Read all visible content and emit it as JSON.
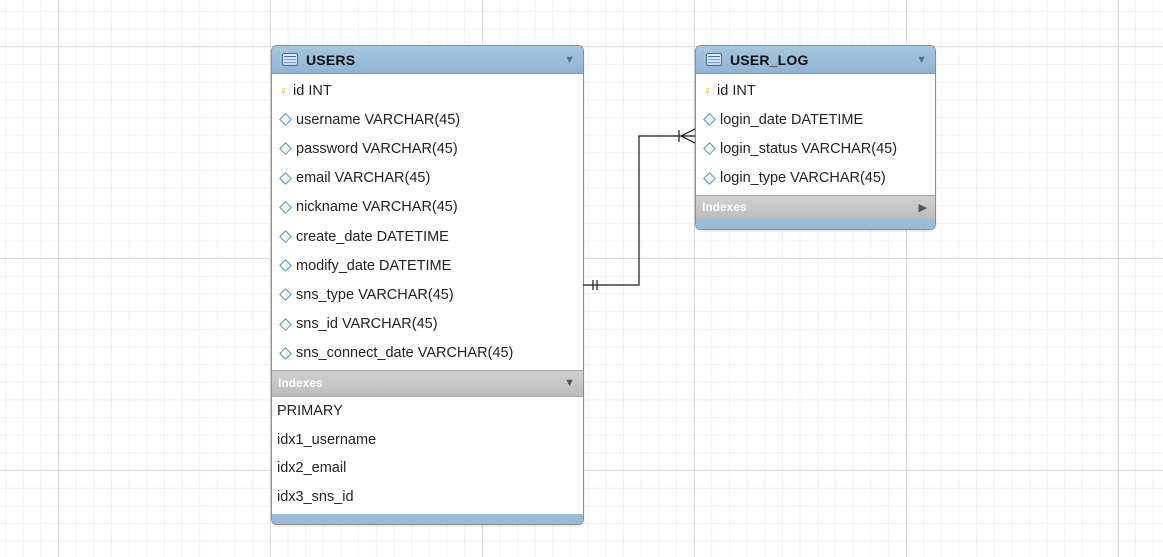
{
  "tables": {
    "users": {
      "name": "USERS",
      "columns": [
        {
          "label": "id INT",
          "key": true
        },
        {
          "label": "username VARCHAR(45)",
          "key": false
        },
        {
          "label": "password VARCHAR(45)",
          "key": false
        },
        {
          "label": "email VARCHAR(45)",
          "key": false
        },
        {
          "label": "nickname VARCHAR(45)",
          "key": false
        },
        {
          "label": "create_date DATETIME",
          "key": false
        },
        {
          "label": "modify_date DATETIME",
          "key": false
        },
        {
          "label": "sns_type VARCHAR(45)",
          "key": false
        },
        {
          "label": "sns_id VARCHAR(45)",
          "key": false
        },
        {
          "label": "sns_connect_date VARCHAR(45)",
          "key": false
        }
      ],
      "indexes_label": "Indexes",
      "indexes": [
        "PRIMARY",
        "idx1_username",
        "idx2_email",
        "idx3_sns_id"
      ]
    },
    "user_log": {
      "name": "USER_LOG",
      "columns": [
        {
          "label": "id INT",
          "key": true
        },
        {
          "label": "login_date DATETIME",
          "key": false
        },
        {
          "label": "login_status VARCHAR(45)",
          "key": false
        },
        {
          "label": "login_type VARCHAR(45)",
          "key": false
        }
      ],
      "indexes_label": "Indexes",
      "indexes": []
    }
  },
  "relationship": {
    "from": "USERS",
    "to": "USER_LOG",
    "from_cardinality": "one",
    "to_cardinality": "many"
  },
  "colors": {
    "header": "#a7c6df",
    "footer": "#98bcd9",
    "index_header": "#c4c4c4",
    "key_icon": "#e0b000",
    "column_icon": "#4a8fbf"
  },
  "icons": {
    "table": "table-icon",
    "primary_key": "key-icon",
    "column": "diamond-icon",
    "collapse": "collapse-triangle-icon",
    "expand": "expand-triangle-icon"
  }
}
